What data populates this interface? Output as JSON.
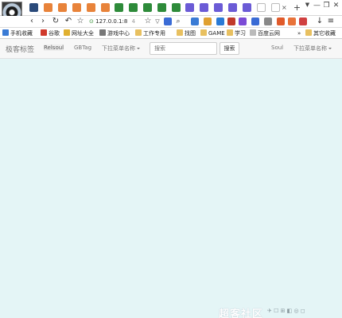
{
  "window_controls": {
    "pin": "▼",
    "minimize": "—",
    "maximize": "❐",
    "close": "✕"
  },
  "tabs": {
    "new_tab": "+",
    "close": "×",
    "icon_colors": [
      "#2a4a7a",
      "#e8833a",
      "#e8833a",
      "#e8833a",
      "#e8833a",
      "#e8833a",
      "#2e8b3a",
      "#2e8b3a",
      "#2e8b3a",
      "#2e8b3a",
      "#2e8b3a",
      "#6b5bd6",
      "#6b5bd6",
      "#6b5bd6",
      "#6b5bd6",
      "#6b5bd6",
      "#cccccc",
      "#cccccc"
    ]
  },
  "toolbar": {
    "back": "‹",
    "forward": "›",
    "reload": "↻",
    "undo": "↶",
    "star": "☆",
    "url": "127.0.0.1:8",
    "url_extra": "4",
    "search_icon": "⌕",
    "download": "↓",
    "menu": "≡",
    "extension_colors": [
      "#3a7bd5",
      "#e0a030",
      "#2a7ad5",
      "#c0392b",
      "#7b4bd6",
      "#3a6bd5",
      "#888888",
      "#e05a2a",
      "#e8733a",
      "#d04040",
      "#555555",
      "#e0a030"
    ]
  },
  "bookmarks": {
    "items": [
      {
        "label": "手机收藏",
        "color": "#3a7bd5"
      },
      {
        "label": "谷歌",
        "color": "#d0392b"
      },
      {
        "label": "网址大全",
        "color": "#e0b030"
      },
      {
        "label": "游戏中心",
        "color": "#777777"
      },
      {
        "label": "工作专用",
        "color": "#e8c060"
      },
      {
        "label": "找图",
        "color": "#e8c060"
      },
      {
        "label": "GAME",
        "color": "#e8c060"
      },
      {
        "label": "学习",
        "color": "#e8c060"
      },
      {
        "label": "百度云网",
        "color": "#bbbbbb"
      }
    ],
    "overflow": "»",
    "other": "其它收藏"
  },
  "navbar": {
    "brand": "极客标签",
    "links": [
      "Relsoul",
      "GBTag"
    ],
    "dropdown": "下拉菜单名称",
    "search_placeholder": "搜索",
    "search_button": "搜索",
    "right_link": "Soul",
    "right_dropdown": "下拉菜单名称"
  },
  "watermark": "超客社区",
  "status_icons": "✈  ☐  ⊞  ◧  ◎  ◻"
}
